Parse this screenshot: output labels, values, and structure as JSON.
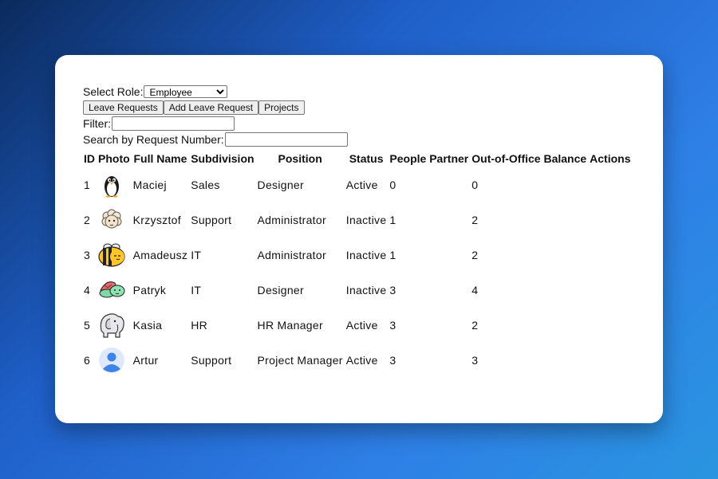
{
  "role": {
    "label": "Select Role:",
    "selected": "Employee",
    "options": [
      "Employee"
    ]
  },
  "nav": {
    "leave_requests": "Leave Requests",
    "add_leave_request": "Add Leave Request",
    "projects": "Projects"
  },
  "filter": {
    "label": "Filter:",
    "value": ""
  },
  "search": {
    "label": "Search by Request Number:",
    "value": ""
  },
  "table": {
    "headers": {
      "id": "ID",
      "photo": "Photo",
      "full_name": "Full Name",
      "subdivision": "Subdivision",
      "position": "Position",
      "status": "Status",
      "people_partner": "People Partner",
      "balance": "Out-of-Office Balance",
      "actions": "Actions"
    },
    "rows": [
      {
        "id": "1",
        "photo": "penguin-avatar",
        "name": "Maciej",
        "subdivision": "Sales",
        "position": "Designer",
        "status": "Active",
        "partner": "0",
        "balance": "0"
      },
      {
        "id": "2",
        "photo": "sheep-avatar",
        "name": "Krzysztof",
        "subdivision": "Support",
        "position": "Administrator",
        "status": "Inactive",
        "partner": "1",
        "balance": "2"
      },
      {
        "id": "3",
        "photo": "bee-avatar",
        "name": "Amadeusz",
        "subdivision": "IT",
        "position": "Administrator",
        "status": "Inactive",
        "partner": "1",
        "balance": "2"
      },
      {
        "id": "4",
        "photo": "turtle-avatar",
        "name": "Patryk",
        "subdivision": "IT",
        "position": "Designer",
        "status": "Inactive",
        "partner": "3",
        "balance": "4"
      },
      {
        "id": "5",
        "photo": "elephant-avatar",
        "name": "Kasia",
        "subdivision": "HR",
        "position": "HR Manager",
        "status": "Active",
        "partner": "3",
        "balance": "2"
      },
      {
        "id": "6",
        "photo": "default-user-avatar",
        "name": "Artur",
        "subdivision": "Support",
        "position": "Project Manager",
        "status": "Active",
        "partner": "3",
        "balance": "3"
      }
    ]
  }
}
